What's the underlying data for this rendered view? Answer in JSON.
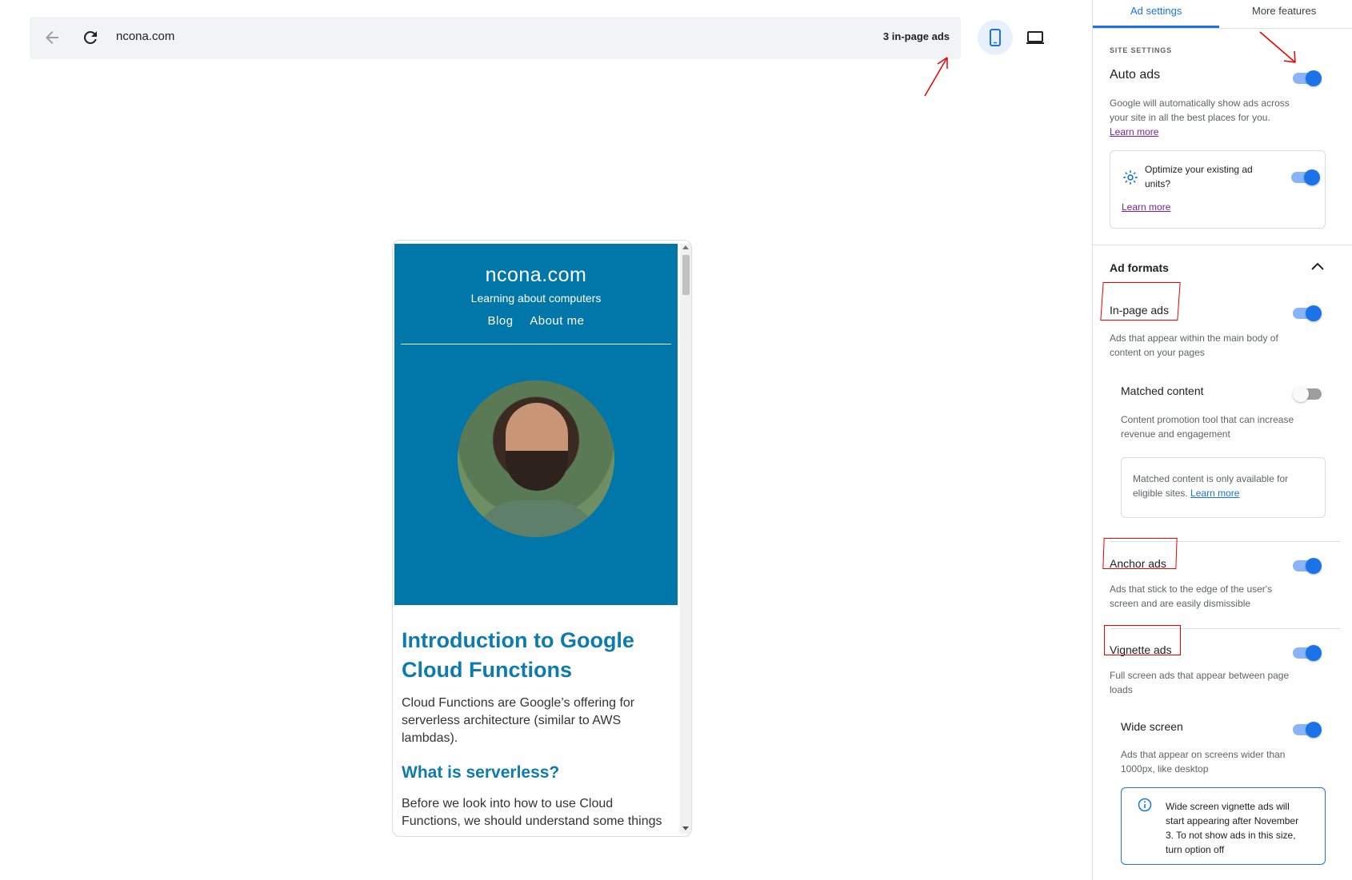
{
  "toolbar": {
    "url": "ncona.com",
    "ads_count": "3 in-page ads"
  },
  "site": {
    "title": "ncona.com",
    "tagline": "Learning about computers",
    "nav": [
      "Blog",
      "About me"
    ],
    "article_title": "Introduction to Google Cloud Functions",
    "paragraph1": "Cloud Functions are Google’s offering for serverless architecture (similar to AWS lambdas).",
    "heading2": "What is serverless?",
    "paragraph2": "Before we look into how to use Cloud Functions, we should understand some things"
  },
  "panel": {
    "tabs": [
      "Ad settings",
      "More features"
    ],
    "site_settings_label": "SITE SETTINGS",
    "auto_ads": {
      "title": "Auto ads",
      "desc": "Google will automatically show ads across your site in all the best places for you.",
      "link": "Learn more",
      "enabled": true
    },
    "optimize": {
      "text": "Optimize your existing ad units?",
      "link": "Learn more",
      "enabled": true
    },
    "ad_formats_title": "Ad formats",
    "in_page": {
      "title": "In-page ads",
      "desc": "Ads that appear within the main body of content on your pages",
      "enabled": true
    },
    "matched": {
      "title": "Matched content",
      "desc": "Content promotion tool that can increase revenue and engagement",
      "note": "Matched content is only available for eligible sites.",
      "link": "Learn more",
      "enabled": false
    },
    "anchor": {
      "title": "Anchor ads",
      "desc": "Ads that stick to the edge of the user's screen and are easily dismissible",
      "enabled": true
    },
    "vignette": {
      "title": "Vignette ads",
      "desc": "Full screen ads that appear between page loads",
      "enabled": true
    },
    "wide": {
      "title": "Wide screen",
      "desc": "Ads that appear on screens wider than 1000px, like desktop",
      "info": "Wide screen vignette ads will start appearing after November 3. To not show ads in this size, turn option off",
      "enabled": true
    }
  },
  "colors": {
    "accent": "#1a73e8",
    "site_header": "#0077a8",
    "annotation": "#ee0000"
  }
}
